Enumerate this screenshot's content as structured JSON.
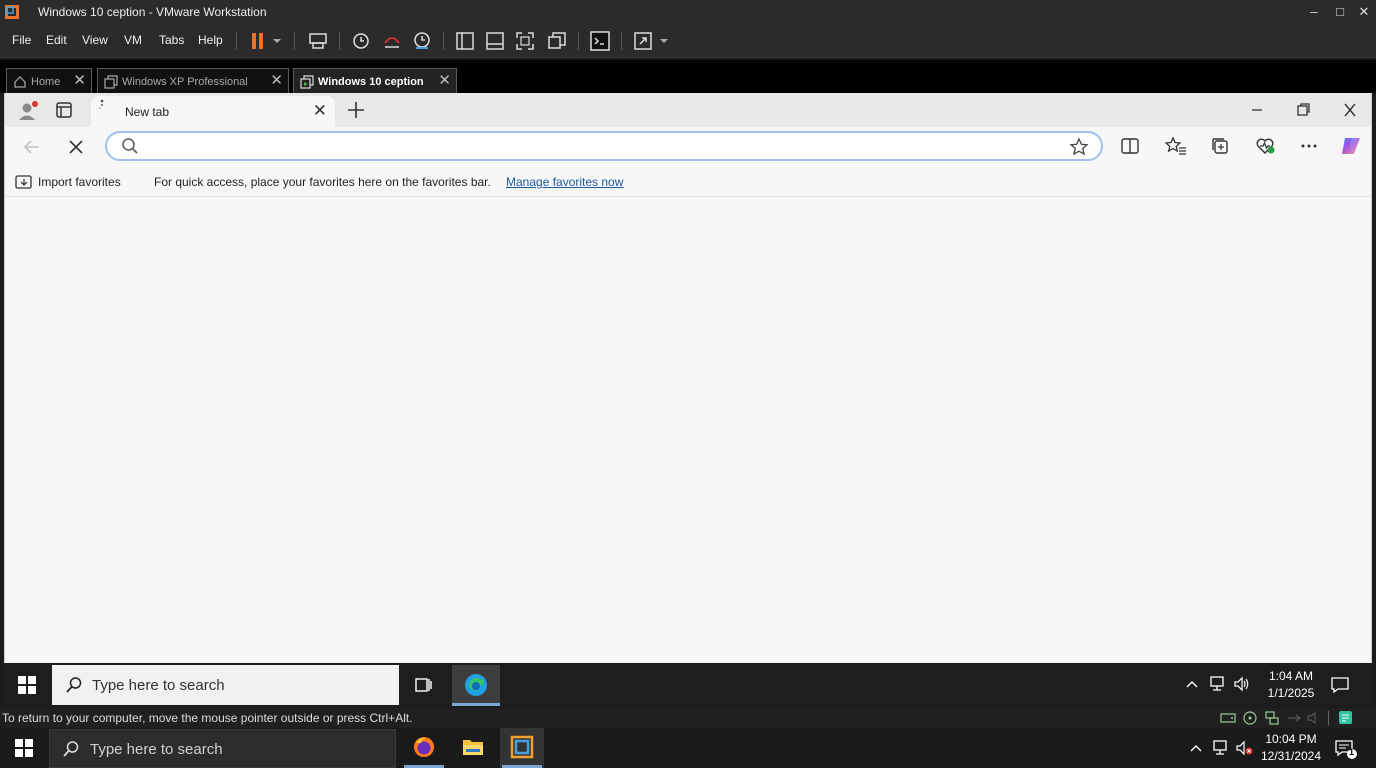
{
  "vmware": {
    "window_title": "Windows 10 ception - VMware Workstation",
    "menus": [
      "File",
      "Edit",
      "View",
      "VM",
      "Tabs",
      "Help"
    ],
    "tabs": [
      {
        "label": "Home",
        "active": false
      },
      {
        "label": "Windows XP Professional",
        "active": false
      },
      {
        "label": "Windows 10 ception",
        "active": true
      }
    ],
    "status_message": "To return to your computer, move the mouse pointer outside or press Ctrl+Alt."
  },
  "edge": {
    "tab_title": "New tab",
    "address": {
      "value": "",
      "placeholder": ""
    },
    "favorites_bar": {
      "import_label": "Import favorites",
      "message": "For quick access, place your favorites here on the favorites bar.",
      "manage_link": "Manage favorites now"
    }
  },
  "guest_taskbar": {
    "search_placeholder": "Type here to search",
    "time": "1:04 AM",
    "date": "1/1/2025"
  },
  "host_taskbar": {
    "search_placeholder": "Type here to search",
    "time": "10:04 PM",
    "date": "12/31/2024",
    "notification_count": "1"
  },
  "icons": {
    "vmware_logo": "vmware-logo-icon",
    "edge_copilot": "copilot-icon"
  },
  "colors": {
    "address_focus": "#9ec2ec",
    "link": "#1a5aa0",
    "pause_orange": "#e8742a",
    "accent_blue": "#0078d4"
  }
}
